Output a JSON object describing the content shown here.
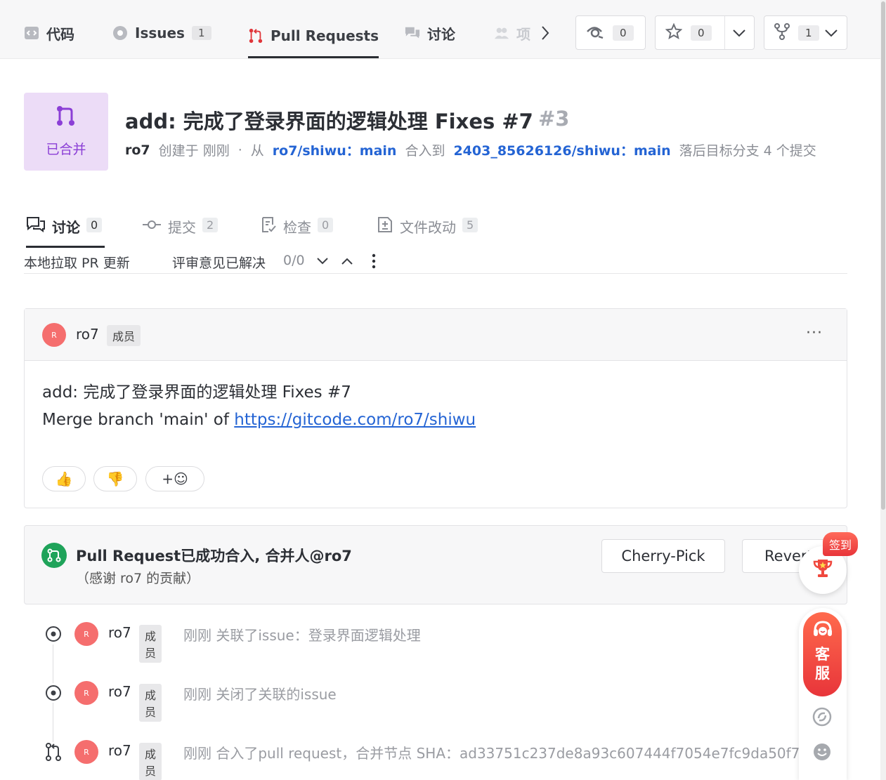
{
  "nav": {
    "tabs": [
      {
        "label": "代码",
        "icon": "code-icon"
      },
      {
        "label": "Issues",
        "icon": "issues-icon",
        "count": "1"
      },
      {
        "label": "Pull Requests",
        "icon": "pull-request-icon",
        "active": true
      },
      {
        "label": "讨论",
        "icon": "discussion-icon"
      },
      {
        "label": "项",
        "icon": "members-icon"
      }
    ],
    "watch_count": "0",
    "star_count": "0",
    "fork_count": "1"
  },
  "pr": {
    "status_label": "已合并",
    "title": "add: 完成了登录界面的逻辑处理 Fixes #7",
    "number": "#3",
    "author": "ro7",
    "created": "创建于 刚刚",
    "dot": "·",
    "from_label": "从",
    "source_branch": "ro7/shiwu：main",
    "into_label": "合入到",
    "target_branch": "2403_85626126/shiwu：main",
    "behind_text": "落后目标分支 4 个提交"
  },
  "subtabs": [
    {
      "label": "讨论",
      "count": "0",
      "icon": "chat-icon"
    },
    {
      "label": "提交",
      "count": "2",
      "icon": "commit-icon"
    },
    {
      "label": "检查",
      "count": "0",
      "icon": "checklist-icon"
    },
    {
      "label": "文件改动",
      "count": "5",
      "icon": "diff-icon"
    }
  ],
  "toolbar": {
    "pull_local": "本地拉取 PR 更新",
    "review_resolved": "评审意见已解决",
    "review_count": "0/0"
  },
  "comment": {
    "avatar_letter": "R",
    "user": "ro7",
    "role": "成员",
    "more": "···",
    "line1": "add: 完成了登录界面的逻辑处理 Fixes #7",
    "line2_prefix": "Merge branch 'main' of ",
    "link": "https://gitcode.com/ro7/shiwu",
    "reactions": [
      "👍",
      "👎",
      "+☺"
    ]
  },
  "merged": {
    "title": "Pull Request已成功合入, 合并人@ro7",
    "subtitle": "（感谢 ro7 的贡献）",
    "cherry_pick": "Cherry-Pick",
    "revert": "Revert"
  },
  "timeline": [
    {
      "icon": "issue-link-icon",
      "avatar": "R",
      "user": "ro7",
      "role": "成员",
      "action": "刚刚 关联了issue：登录界面逻辑处理"
    },
    {
      "icon": "issue-close-icon",
      "avatar": "R",
      "user": "ro7",
      "role": "成员",
      "action": "刚刚 关闭了关联的issue"
    },
    {
      "icon": "merge-icon",
      "avatar": "R",
      "user": "ro7",
      "role": "成员",
      "action": "刚刚 合入了pull request，合并节点 SHA：ad33751c237de8a93c607444f7054e7fc9da50f7"
    }
  ],
  "widgets": {
    "checkin_label": "签到",
    "service_label_1": "客",
    "service_label_2": "服"
  }
}
